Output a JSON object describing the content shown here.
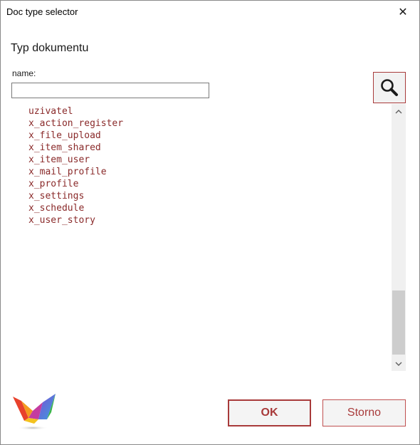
{
  "window": {
    "title": "Doc type selector",
    "close_glyph": "✕"
  },
  "form": {
    "heading": "Typ dokumentu",
    "name_label": "name:",
    "name_value": "",
    "search_icon": "magnifier-icon"
  },
  "list": {
    "items": [
      "uzivatel",
      "x_action_register",
      "x_file_upload",
      "x_item_shared",
      "x_item_user",
      "x_mail_profile",
      "x_profile",
      "x_settings",
      "x_schedule",
      "x_user_story"
    ]
  },
  "scrollbar": {
    "up_glyph": "˄",
    "down_glyph": "˅"
  },
  "buttons": {
    "ok": "OK",
    "storno": "Storno"
  },
  "colors": {
    "accent": "#a83a3a",
    "list_text": "#8a2a2a"
  }
}
